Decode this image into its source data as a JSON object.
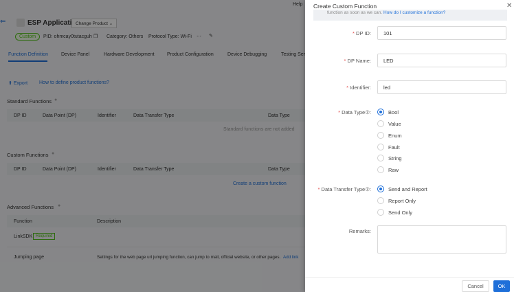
{
  "header": {
    "help": "Help"
  },
  "product": {
    "name": "ESP Application",
    "change_product": "Change Product",
    "tag": "Custom",
    "pid": "PID: ohmcay0tutacguh",
    "category": "Category: Others",
    "protocol": "Protocol Type: Wi-Fi"
  },
  "tabs": [
    {
      "label": "Function Definition",
      "active": true
    },
    {
      "label": "Device Panel"
    },
    {
      "label": "Hardware Development"
    },
    {
      "label": "Product Configuration"
    },
    {
      "label": "Device Debugging"
    },
    {
      "label": "Testing Ser"
    }
  ],
  "actions": {
    "export": "Export",
    "help_link": "How to define product functions?"
  },
  "columns": {
    "dp_id": "DP ID",
    "dp_name": "Data Point (DP)",
    "identifier": "Identifier",
    "transfer": "Data Transfer Type",
    "data_type": "Data Type"
  },
  "standard": {
    "title": "Standard Functions",
    "empty": "Standard functions are not added"
  },
  "custom": {
    "title": "Custom Functions",
    "empty": "Create a custom function"
  },
  "advanced": {
    "title": "Advanced Functions",
    "col_function": "Function",
    "col_description": "Description",
    "rows": [
      {
        "function": "LinkSDK",
        "badge": "Required",
        "description": ""
      },
      {
        "function": "Jumping page",
        "description": "Settings for the web page url jumping function, can jump to mall, official website, or other pages.",
        "action": "Add link"
      }
    ]
  },
  "drawer": {
    "title": "Create Custom Function",
    "notice": "function as soon as we can.",
    "notice_link": "How do I customize a function?",
    "dp_id_label": "DP ID",
    "dp_id": "101",
    "dp_name_label": "DP Name",
    "dp_name": "LED",
    "identifier_label": "Identifier",
    "identifier": "led",
    "data_type_label": "Data Type",
    "data_types": [
      "Bool",
      "Value",
      "Enum",
      "Fault",
      "String",
      "Raw"
    ],
    "data_type_selected": "Bool",
    "transfer_label": "Data Transfer Type",
    "transfers": [
      "Send and Report",
      "Report Only",
      "Send Only"
    ],
    "transfer_selected": "Send and Report",
    "remarks_label": "Remarks",
    "remarks": "",
    "cancel": "Cancel",
    "ok": "OK"
  },
  "colors": {
    "primary": "#1e6fd9",
    "required": "#e34d4d",
    "success": "#52c41a"
  }
}
